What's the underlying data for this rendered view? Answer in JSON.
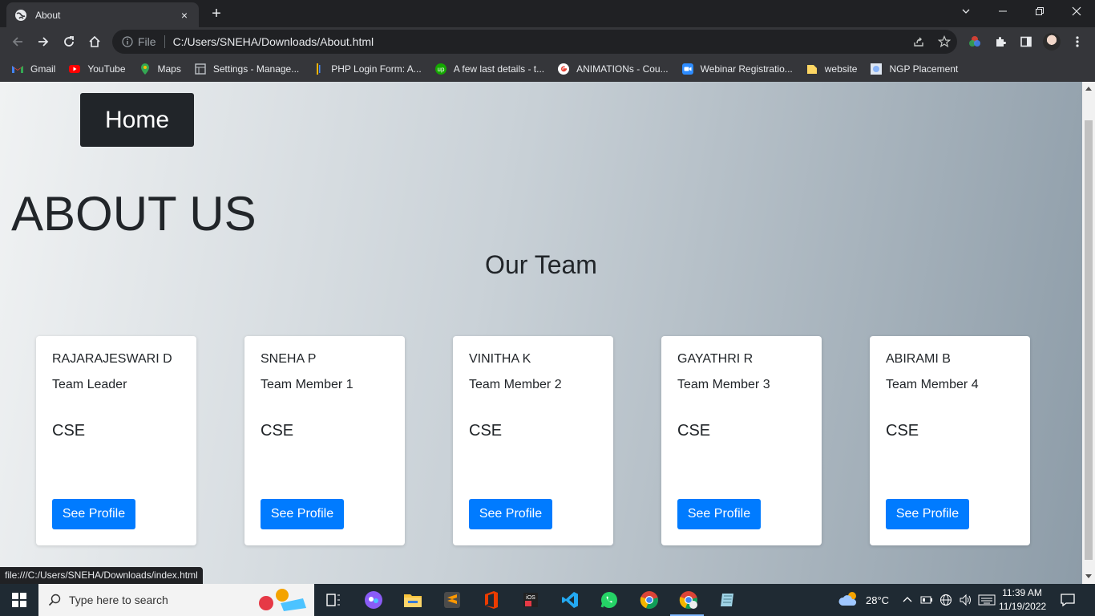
{
  "browser": {
    "tab_title": "About",
    "tab_close": "×",
    "new_tab": "+",
    "omnibox_scheme": "File",
    "url": "C:/Users/SNEHA/Downloads/About.html",
    "status_url": "file:///C:/Users/SNEHA/Downloads/index.html"
  },
  "bookmarks": [
    {
      "label": "Gmail",
      "icon": "gmail-icon",
      "color": "#ea4335"
    },
    {
      "label": "YouTube",
      "icon": "youtube-icon",
      "color": "#ff0000"
    },
    {
      "label": "Maps",
      "icon": "maps-icon",
      "color": "#34a853"
    },
    {
      "label": "Settings - Manage...",
      "icon": "settings-page-icon",
      "color": "#9aa0a6"
    },
    {
      "label": "PHP Login Form: A...",
      "icon": "php-icon",
      "color": "#f4b400"
    },
    {
      "label": "A few last details - t...",
      "icon": "upwork-icon",
      "color": "#14a800"
    },
    {
      "label": "ANIMATIONs - Cou...",
      "icon": "google-icon",
      "color": "#ffffff"
    },
    {
      "label": "Webinar Registratio...",
      "icon": "zoom-icon",
      "color": "#2d8cff"
    },
    {
      "label": "website",
      "icon": "folder-icon",
      "color": "#fdd663"
    },
    {
      "label": "NGP Placement",
      "icon": "ngp-icon",
      "color": "#8ab4f8"
    }
  ],
  "page": {
    "home_button": "Home",
    "about_title": "ABOUT US",
    "team_title": "Our Team",
    "members": [
      {
        "name": "RAJARAJESWARI D",
        "role": "Team Leader",
        "dept": "CSE",
        "button": "See Profile"
      },
      {
        "name": "SNEHA P",
        "role": "Team Member 1",
        "dept": "CSE",
        "button": "See Profile"
      },
      {
        "name": "VINITHA K",
        "role": "Team Member 2",
        "dept": "CSE",
        "button": "See Profile"
      },
      {
        "name": "GAYATHRI R",
        "role": "Team Member 3",
        "dept": "CSE",
        "button": "See Profile"
      },
      {
        "name": "ABIRAMI B",
        "role": "Team Member 4",
        "dept": "CSE",
        "button": "See Profile"
      }
    ]
  },
  "taskbar": {
    "search_placeholder": "Type here to search",
    "weather": "28°C",
    "time": "11:39 AM",
    "date": "11/19/2022"
  },
  "colors": {
    "primary_button": "#007bff",
    "dark_button": "#212529",
    "chrome_dark": "#202124",
    "chrome_toolbar": "#35363a"
  }
}
